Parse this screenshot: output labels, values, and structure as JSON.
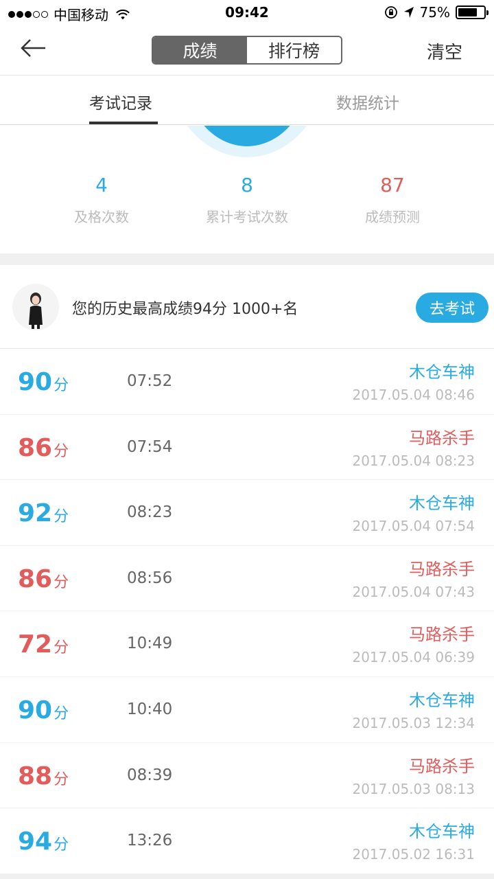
{
  "status_bar": {
    "carrier": "中国移动",
    "time": "09:42",
    "battery_percent": "75%",
    "battery_level": 0.75,
    "icons": [
      "signal-dots-icon",
      "wifi-icon",
      "rotation-lock-icon",
      "location-arrow-icon",
      "battery-icon"
    ]
  },
  "nav": {
    "back_icon": "back-arrow-icon",
    "segments": [
      "成绩",
      "排行榜"
    ],
    "active_segment": 0,
    "clear_label": "清空"
  },
  "tabs": {
    "records_label": "考试记录",
    "stats_label": "数据统计",
    "active": "records"
  },
  "summary": {
    "pass_count": "4",
    "pass_label": "及格次数",
    "total_count": "8",
    "total_label": "累计考试次数",
    "predict_score": "87",
    "predict_label": "成绩预测"
  },
  "best": {
    "text": "您的历史最高成绩94分 1000+名",
    "button_label": "去考试"
  },
  "colors": {
    "blue": "#29abe2",
    "red": "#e35c5c"
  },
  "records": [
    {
      "score": "90",
      "unit": "分",
      "duration": "07:52",
      "title": "木仓车神",
      "date": "2017.05.04 08:46",
      "color": "blue"
    },
    {
      "score": "86",
      "unit": "分",
      "duration": "07:54",
      "title": "马路杀手",
      "date": "2017.05.04 08:23",
      "color": "red"
    },
    {
      "score": "92",
      "unit": "分",
      "duration": "08:23",
      "title": "木仓车神",
      "date": "2017.05.04 07:54",
      "color": "blue"
    },
    {
      "score": "86",
      "unit": "分",
      "duration": "08:56",
      "title": "马路杀手",
      "date": "2017.05.04 07:43",
      "color": "red"
    },
    {
      "score": "72",
      "unit": "分",
      "duration": "10:49",
      "title": "马路杀手",
      "date": "2017.05.04 06:39",
      "color": "red"
    },
    {
      "score": "90",
      "unit": "分",
      "duration": "10:40",
      "title": "木仓车神",
      "date": "2017.05.03 12:34",
      "color": "blue"
    },
    {
      "score": "88",
      "unit": "分",
      "duration": "08:39",
      "title": "马路杀手",
      "date": "2017.05.03 08:13",
      "color": "red"
    },
    {
      "score": "94",
      "unit": "分",
      "duration": "13:26",
      "title": "木仓车神",
      "date": "2017.05.02 16:31",
      "color": "blue"
    }
  ]
}
